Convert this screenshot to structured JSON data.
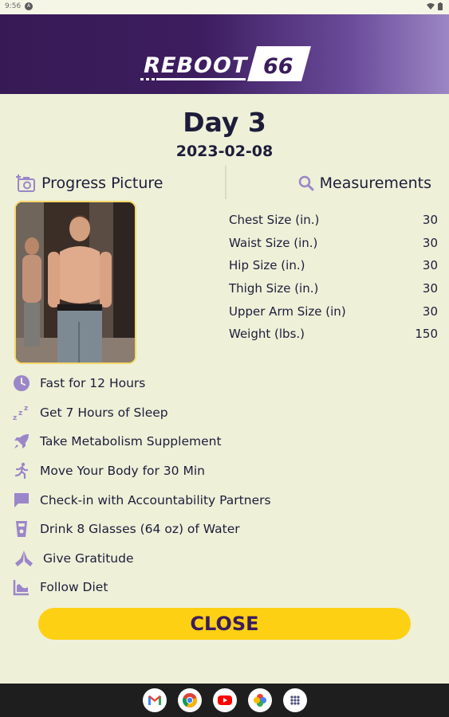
{
  "status_bar": {
    "time": "9:56",
    "indicator": "A"
  },
  "header": {
    "logo_text": "REBOOT",
    "logo_number": "66",
    "background_colors": [
      "#371a55",
      "#9c86c4"
    ]
  },
  "day": {
    "title": "Day 3",
    "date": "2023-02-08"
  },
  "progress": {
    "label": "Progress Picture",
    "icon": "camera-add-icon"
  },
  "measurements": {
    "label": "Measurements",
    "icon": "magnify-icon",
    "items": [
      {
        "label": "Chest Size (in.)",
        "value": "30"
      },
      {
        "label": "Waist Size (in.)",
        "value": "30"
      },
      {
        "label": "Hip Size (in.)",
        "value": "30"
      },
      {
        "label": "Thigh Size (in.)",
        "value": "30"
      },
      {
        "label": "Upper Arm Size (in)",
        "value": "30"
      },
      {
        "label": "Weight (lbs.)",
        "value": "150"
      }
    ]
  },
  "tasks": [
    {
      "label": "Fast for 12 Hours",
      "icon": "clock-icon"
    },
    {
      "label": "Get 7 Hours of Sleep",
      "icon": "sleep-zzz-icon"
    },
    {
      "label": "Take Metabolism Supplement",
      "icon": "rocket-icon"
    },
    {
      "label": "Move Your Body for 30 Min",
      "icon": "running-icon"
    },
    {
      "label": "Check-in with Accountability Partners",
      "icon": "chat-bubble-icon"
    },
    {
      "label": "Drink 8 Glasses (64 oz) of Water",
      "icon": "water-glass-icon"
    },
    {
      "label": "Give Gratitude",
      "icon": "praying-hands-icon"
    },
    {
      "label": "Follow Diet",
      "icon": "diet-chart-icon"
    }
  ],
  "close_button": {
    "label": "CLOSE",
    "color": "#fdd014"
  },
  "accent_color": "#9b86c9",
  "dock": [
    "gmail-icon",
    "chrome-icon",
    "youtube-icon",
    "photos-icon",
    "app-drawer-icon"
  ]
}
